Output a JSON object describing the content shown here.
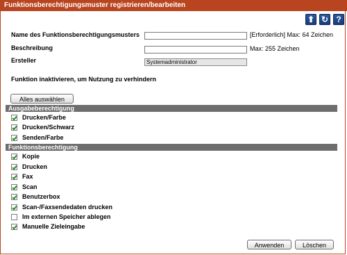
{
  "window": {
    "title": "Funktionsberechtigungsmuster registrieren/bearbeiten"
  },
  "toolbar": {
    "up_icon": "arrow-up-icon",
    "refresh_icon": "refresh-icon",
    "help_icon": "help-icon",
    "up_glyph": "⬆",
    "refresh_glyph": "↻",
    "help_glyph": "?"
  },
  "form": {
    "name_label": "Name des Funktionsberechtigungsmusters",
    "name_value": "",
    "name_hint": "[Erforderlich] Max: 64 Zeichen",
    "desc_label": "Beschreibung",
    "desc_value": "",
    "desc_hint": "Max: 255 Zeichen",
    "creator_label": "Ersteller",
    "creator_value": "Systemadministrator"
  },
  "instruction": "Funktion inaktivieren, um Nutzung zu verhindern",
  "select_all_label": "Alles auswählen",
  "sections": {
    "output": {
      "title": "Ausgabeberechtigung",
      "items": [
        {
          "label": "Drucken/Farbe",
          "checked": true
        },
        {
          "label": "Drucken/Schwarz",
          "checked": true
        },
        {
          "label": "Senden/Farbe",
          "checked": true
        }
      ]
    },
    "function": {
      "title": "Funktionsberechtigung",
      "items": [
        {
          "label": "Kopie",
          "checked": true
        },
        {
          "label": "Drucken",
          "checked": true
        },
        {
          "label": "Fax",
          "checked": true
        },
        {
          "label": "Scan",
          "checked": true
        },
        {
          "label": "Benutzerbox",
          "checked": true
        },
        {
          "label": "Scan-/Faxsendedaten drucken",
          "checked": true
        },
        {
          "label": "Im externen Speicher ablegen",
          "checked": false
        },
        {
          "label": "Manuelle Zieleingabe",
          "checked": true
        }
      ]
    }
  },
  "footer": {
    "apply_label": "Anwenden",
    "delete_label": "Löschen"
  },
  "colors": {
    "titlebar": "#b8451f",
    "section_bar": "#6e6e6e",
    "icon_button": "#2c5aa0",
    "check": "#2e8b2e"
  }
}
